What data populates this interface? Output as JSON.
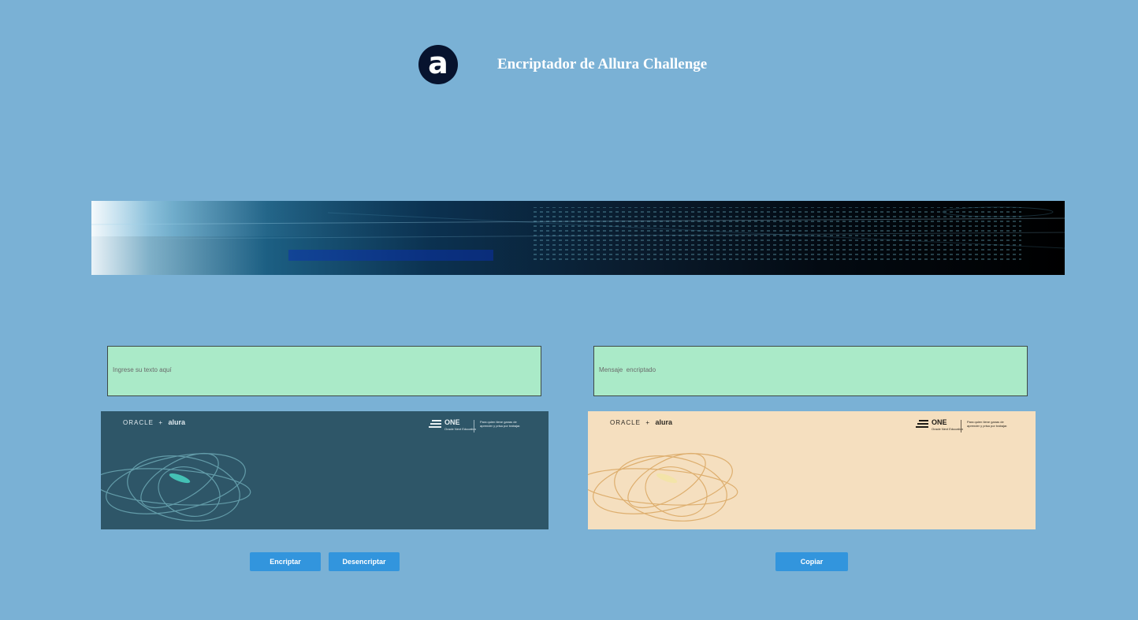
{
  "header": {
    "logo_letter": "a",
    "title": "Encriptador de Allura Challenge"
  },
  "input": {
    "placeholder": "Ingrese su texto aquí",
    "value": ""
  },
  "output": {
    "placeholder": "Mensaje  encriptado",
    "value": ""
  },
  "cards": {
    "left": {
      "brand_oracle": "ORACLE",
      "brand_plus": "+",
      "brand_alura": "alura",
      "one_word": "ONE",
      "one_sub": "Oracle Next Education",
      "tagline": "Para quien tiene ganas de aprender y prisa por trabajar.",
      "swirl_color": "#8fd6df"
    },
    "right": {
      "brand_oracle": "ORACLE",
      "brand_plus": "+",
      "brand_alura": "alura",
      "one_word": "ONE",
      "one_sub": "Oracle Next Education",
      "tagline": "Para quien tiene ganas de aprender y prisa por trabajar.",
      "swirl_color": "#d49a4c"
    }
  },
  "buttons": {
    "encrypt": "Encriptar",
    "decrypt": "Desencriptar",
    "copy": "Copiar"
  },
  "colors": {
    "background": "#7ab1d5",
    "field": "#aaeac8",
    "button": "#3295dd",
    "logo": "#07132e"
  }
}
